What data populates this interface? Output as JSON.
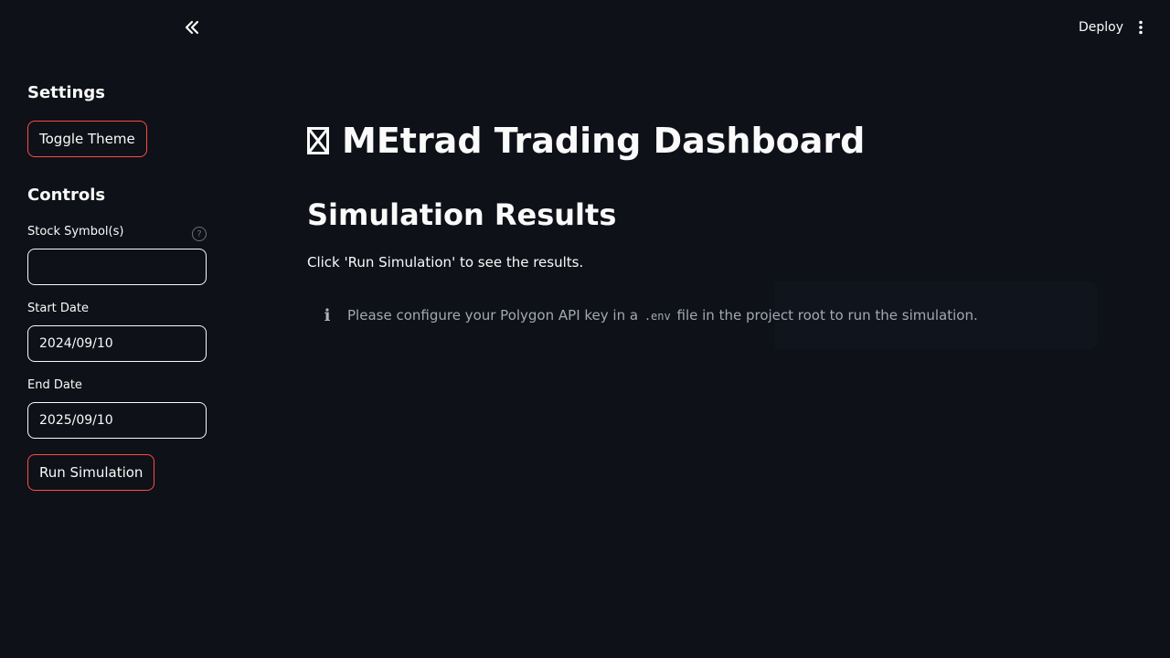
{
  "header": {
    "deploy_label": "Deploy",
    "collapse_icon": "double-chevron-left-icon",
    "menu_icon": "vertical-ellipsis-icon"
  },
  "sidebar": {
    "settings_heading": "Settings",
    "toggle_theme_label": "Toggle Theme",
    "controls_heading": "Controls",
    "stock_symbols": {
      "label": "Stock Symbol(s)",
      "value": "",
      "help_icon": "help-circle-icon"
    },
    "start_date": {
      "label": "Start Date",
      "value": "2024/09/10"
    },
    "end_date": {
      "label": "End Date",
      "value": "2025/09/10"
    },
    "run_simulation_label": "Run Simulation"
  },
  "main": {
    "title": "MEtrad Trading Dashboard",
    "title_glyph": "missing-glyph-box",
    "section_title": "Simulation Results",
    "instructions": "Click 'Run Simulation' to see the results.",
    "alert": {
      "icon": "info-icon",
      "text_before": "Please configure your Polygon API key in a",
      "code": ".env",
      "text_after": "file in the project root to run the simulation."
    }
  },
  "colors": {
    "background": "#0e1117",
    "text": "#fafafa",
    "accent_border": "#ff4b4b",
    "muted_text": "#a3a8b4"
  }
}
